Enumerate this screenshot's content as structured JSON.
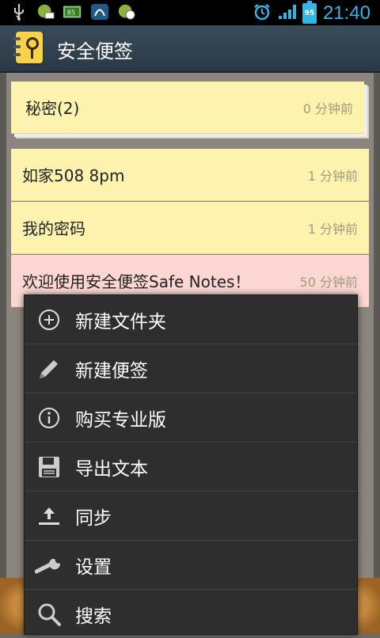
{
  "status_bar": {
    "battery_level": "95",
    "time": "21:40",
    "icons": [
      "usb-icon",
      "message-icon",
      "battery-app-icon",
      "swipe-app-icon",
      "sync-app-icon",
      "alarm-icon",
      "signal-icon",
      "battery-icon"
    ]
  },
  "action_bar": {
    "title": "安全便签",
    "icon": "notebook-key-icon"
  },
  "notes": [
    {
      "title": "秘密(2)",
      "time": "0 分钟前"
    },
    {
      "title": "如家508 8pm",
      "time": "1 分钟前"
    },
    {
      "title": "我的密码",
      "time": "1 分钟前"
    },
    {
      "title": "欢迎使用安全便签Safe Notes！",
      "time": "50 分钟前"
    }
  ],
  "menu": {
    "items": [
      {
        "label": "新建文件夹",
        "icon": "add-circle-icon"
      },
      {
        "label": "新建便签",
        "icon": "pencil-icon"
      },
      {
        "label": "购买专业版",
        "icon": "info-icon"
      },
      {
        "label": "导出文本",
        "icon": "save-icon"
      },
      {
        "label": "同步",
        "icon": "upload-icon"
      },
      {
        "label": "设置",
        "icon": "wrench-icon"
      },
      {
        "label": "搜索",
        "icon": "search-icon"
      }
    ]
  },
  "colors": {
    "note_yellow": "#fdf3ae",
    "note_pink": "#fbd6d3",
    "accent_blue": "#33b5e5"
  }
}
